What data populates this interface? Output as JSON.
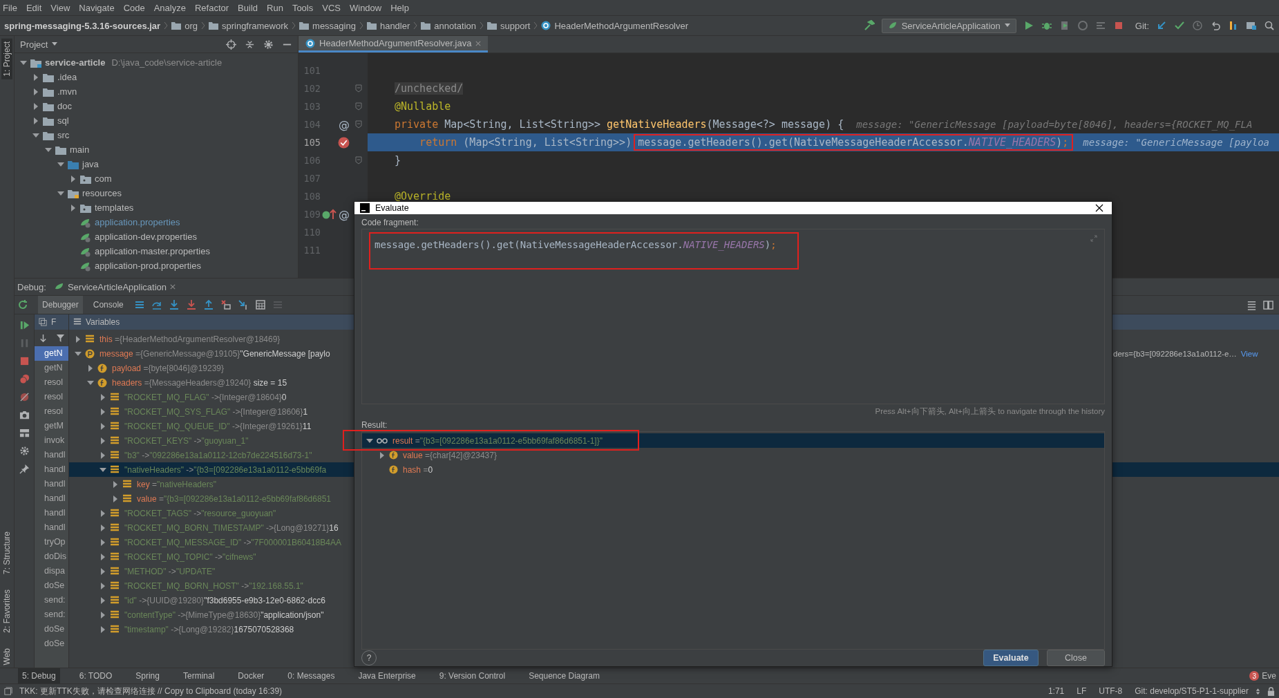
{
  "menu": [
    "File",
    "Edit",
    "View",
    "Navigate",
    "Code",
    "Analyze",
    "Refactor",
    "Build",
    "Run",
    "Tools",
    "VCS",
    "Window",
    "Help"
  ],
  "breadcrumbs": [
    {
      "label": "spring-messaging-5.3.16-sources.jar",
      "kind": "jar"
    },
    {
      "label": "org",
      "kind": "package"
    },
    {
      "label": "springframework",
      "kind": "package"
    },
    {
      "label": "messaging",
      "kind": "package"
    },
    {
      "label": "handler",
      "kind": "package"
    },
    {
      "label": "annotation",
      "kind": "package"
    },
    {
      "label": "support",
      "kind": "package"
    },
    {
      "label": "HeaderMethodArgumentResolver",
      "kind": "class"
    }
  ],
  "run_config": "ServiceArticleApplication",
  "git_label": "Git:",
  "side_tabs": {
    "top": [
      {
        "label": "1: Project",
        "selected": true
      }
    ],
    "bottom": [
      {
        "label": "7: Structure",
        "selected": false
      },
      {
        "label": "2: Favorites",
        "selected": false
      },
      {
        "label": "Web",
        "selected": false
      }
    ]
  },
  "project": {
    "title": "Project",
    "tree": [
      {
        "name": "service-article",
        "path": "D:\\java_code\\service-article",
        "kind": "module",
        "expanded": true,
        "children": [
          {
            "name": ".idea",
            "kind": "folder",
            "expanded": false
          },
          {
            "name": ".mvn",
            "kind": "folder",
            "expanded": false
          },
          {
            "name": "doc",
            "kind": "folder",
            "expanded": false
          },
          {
            "name": "sql",
            "kind": "folder",
            "expanded": false
          },
          {
            "name": "src",
            "kind": "folder",
            "expanded": true,
            "children": [
              {
                "name": "main",
                "kind": "folder",
                "expanded": true,
                "children": [
                  {
                    "name": "java",
                    "kind": "source",
                    "expanded": true,
                    "children": [
                      {
                        "name": "com",
                        "kind": "package",
                        "expanded": false
                      }
                    ]
                  },
                  {
                    "name": "resources",
                    "kind": "resources",
                    "expanded": true,
                    "children": [
                      {
                        "name": "templates",
                        "kind": "package",
                        "expanded": false
                      },
                      {
                        "name": "application.properties",
                        "kind": "spring",
                        "modified": true
                      },
                      {
                        "name": "application-dev.properties",
                        "kind": "spring",
                        "modified": false
                      },
                      {
                        "name": "application-master.properties",
                        "kind": "spring",
                        "modified": false
                      },
                      {
                        "name": "application-prod.properties",
                        "kind": "spring",
                        "modified": false
                      }
                    ]
                  }
                ]
              }
            ]
          }
        ]
      }
    ]
  },
  "editor": {
    "tab": "HeaderMethodArgumentResolver.java",
    "lines": [
      {
        "number": "101",
        "selected": false,
        "breakpoint": false,
        "fold": false,
        "implements": false
      },
      {
        "number": "102",
        "tokens": [
          {
            "kind": "comment",
            "text": "/unchecked/"
          }
        ],
        "selected": false,
        "breakpoint": false,
        "fold": true,
        "implements": false
      },
      {
        "number": "103",
        "tokens": [
          {
            "kind": "annotation",
            "text": "@Nullable"
          }
        ],
        "selected": false,
        "breakpoint": false,
        "fold": true,
        "implements": false
      },
      {
        "number": "104",
        "mark": "@",
        "tokens": [
          {
            "kind": "keyword",
            "text": "private "
          },
          {
            "kind": "plain",
            "text": "Map<String, List<String>> "
          },
          {
            "kind": "method",
            "text": "getNativeHeaders"
          },
          {
            "kind": "plain",
            "text": "(Message<?> message) {"
          }
        ],
        "hint": "message: \"GenericMessage [payload=byte[8046], headers={ROCKET_MQ_FLA",
        "selected": false,
        "breakpoint": false,
        "fold": true,
        "implements": false
      },
      {
        "number": "105",
        "tokens": [
          {
            "kind": "keyword",
            "text": "    return ",
            "boxed": false
          },
          {
            "kind": "plain",
            "text": "(Map<String, List<String>>)",
            "boxed": false
          },
          {
            "kind": "plain",
            "text": "message.getHeaders().get(NativeMessageHeaderAccessor.",
            "boxed": true
          },
          {
            "kind": "constant",
            "text": "NATIVE_HEADERS",
            "boxed": true
          },
          {
            "kind": "plain",
            "text": ")",
            "boxed": true
          },
          {
            "kind": "keyword",
            "text": ";",
            "boxed": true
          }
        ],
        "hint": "message: \"GenericMessage [payloa",
        "selected": true,
        "breakpoint": true,
        "fold": false,
        "implements": false
      },
      {
        "number": "106",
        "tokens": [
          {
            "kind": "plain",
            "text": "}"
          }
        ],
        "selected": false,
        "breakpoint": false,
        "fold": true,
        "implements": false
      },
      {
        "number": "107",
        "selected": false,
        "breakpoint": false,
        "fold": false,
        "implements": false
      },
      {
        "number": "108",
        "tokens": [
          {
            "kind": "annotation",
            "text": "@Override"
          }
        ],
        "selected": false,
        "breakpoint": false,
        "fold": false,
        "implements": false
      },
      {
        "number": "109",
        "mark": "@",
        "selected": false,
        "breakpoint": false,
        "fold": false,
        "implements": true
      },
      {
        "number": "110",
        "selected": false,
        "breakpoint": false,
        "fold": false,
        "implements": false
      },
      {
        "number": "111",
        "selected": false,
        "breakpoint": false,
        "fold": false,
        "implements": false
      }
    ]
  },
  "debug": {
    "label": "Debug:",
    "session": "ServiceArticleApplication",
    "tabs": [
      {
        "label": "Debugger",
        "selected": true
      },
      {
        "label": "Console",
        "selected": false
      }
    ],
    "frames_header": "F",
    "variables_header": "Variables",
    "frames": [
      {
        "name": "getN",
        "selected": true
      },
      {
        "name": "getN",
        "selected": false
      },
      {
        "name": "resol",
        "selected": false
      },
      {
        "name": "resol",
        "selected": false
      },
      {
        "name": "resol",
        "selected": false
      },
      {
        "name": "getM",
        "selected": false
      },
      {
        "name": "invok",
        "selected": false
      },
      {
        "name": "handl",
        "selected": false
      },
      {
        "name": "handl",
        "selected": false
      },
      {
        "name": "handl",
        "selected": false
      },
      {
        "name": "handl",
        "selected": false
      },
      {
        "name": "handl",
        "selected": false
      },
      {
        "name": "handl",
        "selected": false
      },
      {
        "name": "tryOp",
        "selected": false
      },
      {
        "name": "doDis",
        "selected": false
      },
      {
        "name": "dispa",
        "selected": false
      },
      {
        "name": "doSe",
        "selected": false
      },
      {
        "name": "send:",
        "selected": false
      },
      {
        "name": "send:",
        "selected": false
      },
      {
        "name": "doSe",
        "selected": false
      },
      {
        "name": "doSe",
        "selected": false
      }
    ],
    "variables": [
      {
        "kind": "local",
        "name": "this",
        "sep": "=",
        "ref": "{HeaderMethodArgumentResolver@18469}",
        "expanded": false,
        "selected": false
      },
      {
        "kind": "param",
        "name": "message",
        "sep": "=",
        "ref": "{GenericMessage@19105}",
        "value": "\"GenericMessage [paylo",
        "tail": "ders={b3=[092286e13a1a0112-e…",
        "tail_link": "View",
        "expanded": true,
        "selected": false,
        "children": [
          {
            "kind": "field",
            "name": "payload",
            "sep": "=",
            "ref": "{byte[8046]@19239}",
            "expanded": false,
            "selected": false
          },
          {
            "kind": "field",
            "name": "headers",
            "sep": "=",
            "ref": "{MessageHeaders@19240}",
            "value": " size = 15",
            "expanded": true,
            "selected": false,
            "children": [
              {
                "kind": "entry",
                "name": "\"ROCKET_MQ_FLAG\"",
                "sep": "->",
                "ref": "{Integer@18604}",
                "value": "0",
                "expanded": false,
                "selected": false
              },
              {
                "kind": "entry",
                "name": "\"ROCKET_MQ_SYS_FLAG\"",
                "sep": "->",
                "ref": "{Integer@18606}",
                "value": "1",
                "expanded": false,
                "selected": false
              },
              {
                "kind": "entry",
                "name": "\"ROCKET_MQ_QUEUE_ID\"",
                "sep": "->",
                "ref": "{Integer@19261}",
                "value": "11",
                "expanded": false,
                "selected": false
              },
              {
                "kind": "entry",
                "name": "\"ROCKET_KEYS\"",
                "sep": "->",
                "str": "\"guoyuan_1\"",
                "expanded": false,
                "selected": false
              },
              {
                "kind": "entry",
                "name": "\"b3\"",
                "sep": "->",
                "str": "\"092286e13a1a0112-12cb7de224516d73-1\"",
                "expanded": false,
                "selected": false
              },
              {
                "kind": "entry",
                "name": "\"nativeHeaders\"",
                "sep": "->",
                "str": "\"{b3=[092286e13a1a0112-e5bb69fa",
                "expanded": true,
                "selected": true,
                "children": [
                  {
                    "kind": "local",
                    "name": "key",
                    "sep": "=",
                    "str": "\"nativeHeaders\"",
                    "expanded": false,
                    "selected": false
                  },
                  {
                    "kind": "local",
                    "name": "value",
                    "sep": "=",
                    "str": "\"{b3=[092286e13a1a0112-e5bb69faf86d6851",
                    "expanded": false,
                    "selected": false
                  }
                ]
              },
              {
                "kind": "entry",
                "name": "\"ROCKET_TAGS\"",
                "sep": "->",
                "str": "\"resource_guoyuan\"",
                "expanded": false,
                "selected": false
              },
              {
                "kind": "entry",
                "name": "\"ROCKET_MQ_BORN_TIMESTAMP\"",
                "sep": "->",
                "ref": "{Long@19271}",
                "value": "16",
                "expanded": false,
                "selected": false
              },
              {
                "kind": "entry",
                "name": "\"ROCKET_MQ_MESSAGE_ID\"",
                "sep": "->",
                "str": "\"7F000001B60418B4AA",
                "expanded": false,
                "selected": false
              },
              {
                "kind": "entry",
                "name": "\"ROCKET_MQ_TOPIC\"",
                "sep": "->",
                "str": "\"cifnews\"",
                "expanded": false,
                "selected": false
              },
              {
                "kind": "entry",
                "name": "\"METHOD\"",
                "sep": "->",
                "str": "\"UPDATE\"",
                "expanded": false,
                "selected": false
              },
              {
                "kind": "entry",
                "name": "\"ROCKET_MQ_BORN_HOST\"",
                "sep": "->",
                "str": "\"192.168.55.1\"",
                "expanded": false,
                "selected": false
              },
              {
                "kind": "entry",
                "name": "\"id\"",
                "sep": "->",
                "ref": "{UUID@19280}",
                "value": "\"f3bd6955-e9b3-12e0-6862-dcc6",
                "expanded": false,
                "selected": false
              },
              {
                "kind": "entry",
                "name": "\"contentType\"",
                "sep": "->",
                "ref": "{MimeType@18630}",
                "value": "\"application/json\"",
                "expanded": false,
                "selected": false
              },
              {
                "kind": "entry",
                "name": "\"timestamp\"",
                "sep": "->",
                "ref": "{Long@19282}",
                "value": "1675070528368",
                "expanded": false,
                "selected": false
              }
            ]
          }
        ]
      }
    ]
  },
  "tool_tabs": [
    {
      "label": "5: Debug",
      "selected": true
    },
    {
      "label": "6: TODO",
      "selected": false
    },
    {
      "label": "Spring",
      "selected": false
    },
    {
      "label": "Terminal",
      "selected": false
    },
    {
      "label": "Docker",
      "selected": false
    },
    {
      "label": "0: Messages",
      "selected": false
    },
    {
      "label": "Java Enterprise",
      "selected": false
    },
    {
      "label": "9: Version Control",
      "selected": false
    },
    {
      "label": "Sequence Diagram",
      "selected": false
    }
  ],
  "event_log": {
    "count": "3",
    "label": "Eve"
  },
  "status": {
    "message": "TKK: 更新TTK失败，请检查网络连接 // Copy to Clipboard (today 16:39)",
    "position": "1:71",
    "line_sep": "LF",
    "encoding": "UTF-8",
    "branch": "Git: develop/ST5-P1-1-supplier"
  },
  "evaluate": {
    "title": "Evaluate",
    "code_label": "Code fragment:",
    "code": [
      {
        "kind": "plain",
        "text": "message.getHeaders().get(NativeMessageHeaderAccessor."
      },
      {
        "kind": "constant",
        "text": "NATIVE_HEADERS"
      },
      {
        "kind": "plain",
        "text": ")"
      },
      {
        "kind": "keyword",
        "text": ";"
      }
    ],
    "hint": "Press Alt+向下箭头, Alt+向上箭头 to navigate through the history",
    "result_label": "Result:",
    "result": [
      {
        "kind": "watch",
        "name": "result",
        "sep": "=",
        "str": "\"{b3=[092286e13a1a0112-e5bb69faf86d6851-1]}\"",
        "expanded": true,
        "selected": true,
        "children": [
          {
            "kind": "field",
            "name": "value",
            "sep": "=",
            "ref": "{char[42]@23437}",
            "expanded": false,
            "selected": false
          },
          {
            "kind": "field",
            "name": "hash",
            "sep": "=",
            "value": "0",
            "selected": false
          }
        ]
      }
    ],
    "help": "?",
    "buttons": [
      {
        "label": "Evaluate",
        "kind": "primary"
      },
      {
        "label": "Close",
        "kind": "secondary"
      }
    ]
  }
}
